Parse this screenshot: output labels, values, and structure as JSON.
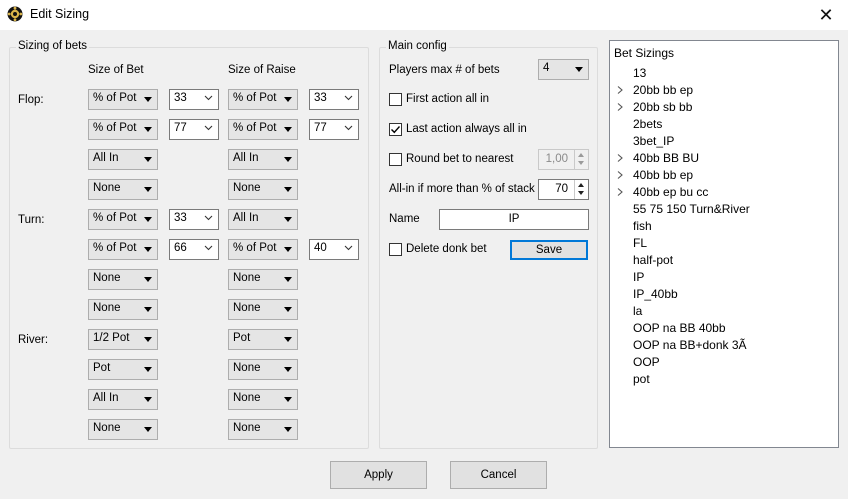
{
  "window": {
    "title": "Edit Sizing",
    "icon": "poker-chip-icon",
    "close": "✕"
  },
  "sizing": {
    "group_title": "Sizing of bets",
    "col_bet": "Size of Bet",
    "col_raise": "Size of Raise",
    "flop": {
      "label": "Flop:",
      "rows": [
        {
          "bet": "% of Pot",
          "bet_val": "33",
          "raise": "% of Pot",
          "raise_val": "33"
        },
        {
          "bet": "% of Pot",
          "bet_val": "77",
          "raise": "% of Pot",
          "raise_val": "77"
        },
        {
          "bet": "All In",
          "raise": "All In"
        },
        {
          "bet": "None",
          "raise": "None"
        }
      ]
    },
    "turn": {
      "label": "Turn:",
      "rows": [
        {
          "bet": "% of Pot",
          "bet_val": "33",
          "raise": "All In"
        },
        {
          "bet": "% of Pot",
          "bet_val": "66",
          "raise": "% of Pot",
          "raise_val": "40"
        },
        {
          "bet": "None",
          "raise": "None"
        },
        {
          "bet": "None",
          "raise": "None"
        }
      ]
    },
    "river": {
      "label": "River:",
      "rows": [
        {
          "bet": "1/2 Pot",
          "raise": "Pot"
        },
        {
          "bet": "Pot",
          "raise": "None"
        },
        {
          "bet": "All In",
          "raise": "None"
        },
        {
          "bet": "None",
          "raise": "None"
        }
      ]
    }
  },
  "main_config": {
    "group_title": "Main config",
    "players_label": "Players max # of bets",
    "players_value": "4",
    "first_action_label": "First action all in",
    "first_action_checked": false,
    "last_action_label": "Last action always all in",
    "last_action_checked": true,
    "round_label": "Round bet to nearest",
    "round_checked": false,
    "round_value": "1,00",
    "allin_label": "All-in if more than % of stack",
    "allin_value": "70",
    "name_label": "Name",
    "name_value": "IP",
    "delete_donk_label": "Delete donk bet",
    "delete_donk_checked": false,
    "save_label": "Save"
  },
  "bet_sizings": {
    "header": "Bet Sizings",
    "items": [
      {
        "label": "13",
        "expandable": false
      },
      {
        "label": "20bb bb ep",
        "expandable": true
      },
      {
        "label": "20bb sb bb",
        "expandable": true
      },
      {
        "label": "2bets",
        "expandable": false
      },
      {
        "label": "3bet_IP",
        "expandable": false
      },
      {
        "label": "40bb BB BU",
        "expandable": true
      },
      {
        "label": "40bb bb ep",
        "expandable": true
      },
      {
        "label": "40bb ep bu cc",
        "expandable": true
      },
      {
        "label": "55 75 150 Turn&River",
        "expandable": false
      },
      {
        "label": "fish",
        "expandable": false
      },
      {
        "label": "FL",
        "expandable": false
      },
      {
        "label": "half-pot",
        "expandable": false
      },
      {
        "label": "IP",
        "expandable": false
      },
      {
        "label": "IP_40bb",
        "expandable": false
      },
      {
        "label": "la",
        "expandable": false
      },
      {
        "label": "OOP na BB 40bb",
        "expandable": false
      },
      {
        "label": "OOP na BB+donk 3Ã",
        "expandable": false
      },
      {
        "label": "OOP",
        "expandable": false
      },
      {
        "label": "pot",
        "expandable": false
      }
    ]
  },
  "footer": {
    "apply_label": "Apply",
    "cancel_label": "Cancel"
  }
}
